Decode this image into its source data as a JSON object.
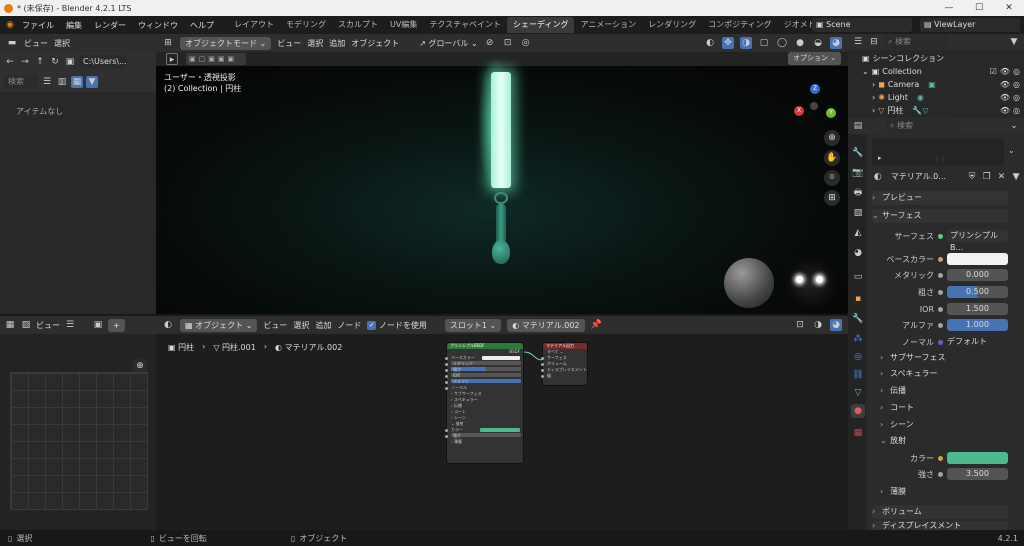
{
  "title_bar": {
    "title": "* (未保存) - Blender 4.2.1 LTS",
    "minimize": "—",
    "maximize": "☐",
    "close": "✕"
  },
  "top_menu": {
    "items": [
      "ファイル",
      "編集",
      "レンダー",
      "ウィンドウ",
      "ヘルプ"
    ]
  },
  "workspaces": {
    "tabs": [
      "レイアウト",
      "モデリング",
      "スカルプト",
      "UV編集",
      "テクスチャペイント",
      "シェーディング",
      "アニメーション",
      "レンダリング",
      "コンポジティング",
      "ジオメトリ..."
    ],
    "active": "シェーディング"
  },
  "scene": {
    "label": "Scene",
    "view_layer": "ViewLayer"
  },
  "file_browser": {
    "menu_view": "ビュー",
    "menu_select": "選択",
    "path": "C:\\Users\\...",
    "search_placeholder": "検索",
    "empty_text": "アイテムなし"
  },
  "viewport": {
    "mode": "オブジェクトモード",
    "menu_view": "ビュー",
    "menu_select": "選択",
    "menu_add": "追加",
    "menu_object": "オブジェクト",
    "transform": "グローバル",
    "options": "オプション",
    "overlay_line1": "ユーザー・透視投影",
    "overlay_line2": "(2) Collection | 円柱",
    "gizmo_x": "X",
    "gizmo_y": "Y",
    "gizmo_z": "Z"
  },
  "image_editor": {
    "menu_view": "ビュー"
  },
  "node_editor": {
    "mode": "オブジェクト",
    "menu_view": "ビュー",
    "menu_select": "選択",
    "menu_add": "追加",
    "menu_node": "ノード",
    "use_nodes": "ノードを使用",
    "slot": "スロット1",
    "material": "マテリアル.002",
    "breadcrumb_object": "円柱",
    "breadcrumb_mesh": "円柱.001",
    "breadcrumb_material": "マテリアル.002",
    "bsdf_node_title": "プリンシプルBSDF",
    "bsdf_rows": [
      "ベースカラー",
      "メタリック",
      "粗さ",
      "IOR",
      "アルファ",
      "ノーマル",
      "サブサーフェス",
      "スペキュラー",
      "伝播",
      "コート",
      "シーン",
      "放射",
      "カラー",
      "強さ",
      "薄膜"
    ],
    "output_node_title": "マテリアル出力",
    "output_rows": [
      "すべて",
      "サーフェス",
      "ボリューム",
      "ディスプレイスメント",
      "幅"
    ]
  },
  "outliner": {
    "search_placeholder": "検索",
    "root": "シーンコレクション",
    "items": [
      {
        "name": "Collection"
      },
      {
        "name": "Camera"
      },
      {
        "name": "Light"
      },
      {
        "name": "円柱"
      }
    ]
  },
  "properties": {
    "search_placeholder": "検索",
    "material_name": "マテリアル.0...",
    "preview": "プレビュー",
    "surface_section": "サーフェス",
    "surface_label": "サーフェス",
    "surface_value": "プリンシプルB...",
    "base_color_label": "ベースカラー",
    "base_color": "#f2f2f2",
    "metallic_label": "メタリック",
    "metallic": "0.000",
    "roughness_label": "粗さ",
    "roughness": "0.500",
    "roughness_fraction": 0.5,
    "ior_label": "IOR",
    "ior": "1.500",
    "alpha_label": "アルファ",
    "alpha": "1.000",
    "alpha_fraction": 1.0,
    "normal_label": "ノーマル",
    "normal": "デフォルト",
    "sections": [
      "サブサーフェス",
      "スペキュラー",
      "伝播",
      "コート",
      "シーン"
    ],
    "emission": "放射",
    "emission_color_label": "カラー",
    "emission_color": "#4dba8e",
    "strength_label": "強さ",
    "strength": "3.500",
    "thin_film": "薄膜",
    "volume": "ボリューム",
    "displacement": "ディスプレイスメント"
  },
  "status_bar": {
    "select": "選択",
    "rotate": "ビューを回転",
    "object": "オブジェクト",
    "version": "4.2.1"
  },
  "colors": {
    "accent_blue": "#4772b3",
    "emission": "#4dba8e"
  }
}
